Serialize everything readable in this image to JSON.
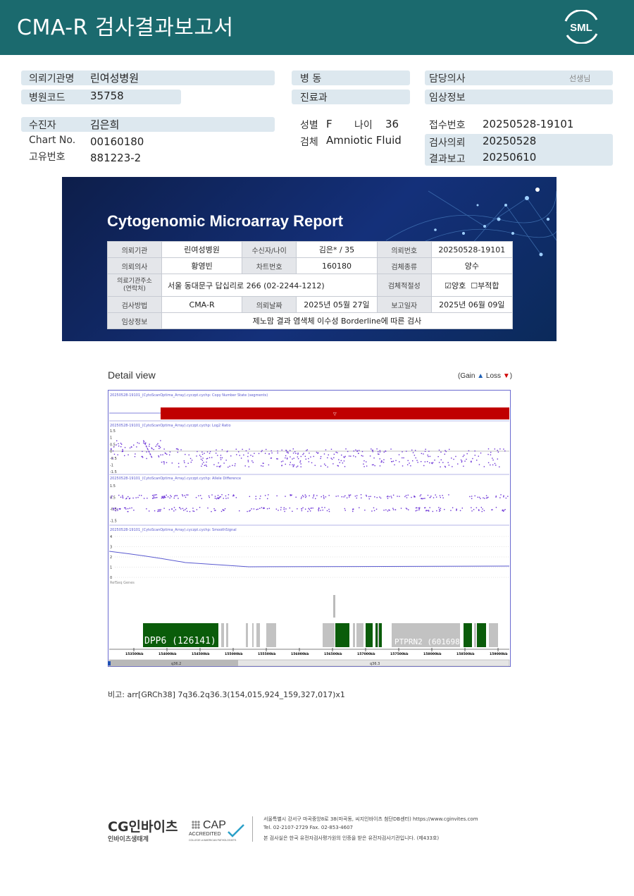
{
  "header": {
    "title": "CMA-R 검사결과보고서",
    "logo_text": "SML"
  },
  "info": {
    "institution_label": "의뢰기관명",
    "institution_value": "린여성병원",
    "hospital_code_label": "병원코드",
    "hospital_code_value": "35758",
    "ward_label": "병  동",
    "department_label": "진료과",
    "doctor_label": "담당의사",
    "doctor_suffix": "선생님",
    "clinical_info_label": "임상정보",
    "patient_label": "수진자",
    "patient_value": "김은희",
    "chart_label": "Chart No.",
    "chart_value": "00160180",
    "unique_label": "고유번호",
    "unique_value": "881223-2",
    "sex_label": "성별",
    "sex_value": "F",
    "age_label": "나이",
    "age_value": "36",
    "specimen_label": "검체",
    "specimen_value": "Amniotic Fluid",
    "receipt_label": "접수번호",
    "receipt_value": "20250528-19101",
    "request_label": "검사의뢰",
    "request_value": "20250528",
    "result_label": "결과보고",
    "result_value": "20250610"
  },
  "report": {
    "title": "Cytogenomic Microarray Report",
    "r1": [
      "의뢰기관",
      "린여성병원",
      "수신자/나이",
      "김은* / 35",
      "의뢰번호",
      "20250528-19101"
    ],
    "r2": [
      "의뢰의사",
      "황영빈",
      "차트번호",
      "160180",
      "검체종류",
      "양수"
    ],
    "r3": [
      "의료기관주소\n(연락처)",
      "서울 동대문구 답십리로 266 (02-2244-1212)",
      "검체적절성",
      "양호",
      "부적합"
    ],
    "r4": [
      "검사방법",
      "CMA-R",
      "의뢰날짜",
      "2025년 05월 27일",
      "보고일자",
      "2025년 06월 09일"
    ],
    "r5": [
      "임상정보",
      "제노맘 결과 염색체 이수성 Borderline에 따른 검사"
    ]
  },
  "detail": {
    "title": "Detail view",
    "legend_prefix": "(Gain",
    "legend_loss": "Loss",
    "legend_suffix": ")",
    "track1_label": "20250528-19101_(CytoScanOptima_Array).cyczpt.cychp: Copy Number State (segments)",
    "track2_label": "20250528-19101_(CytoScanOptima_Array).cyczpt.cychp: Log2 Ratio",
    "track3_label": "20250528-19101_(CytoScanOptima_Array).cyczpt.cychp: Allele Difference",
    "track4_label": "20250528-19101_(CytoScanOptima_Array).cyczpt.cychp: SmoothSignal",
    "log2_ticks": [
      "1.5",
      "1",
      "0.5",
      "0",
      "-0.5",
      "-1",
      "-1.5"
    ],
    "allele_ticks": [
      "1.5",
      "0.5",
      "-0.5",
      "-1.5"
    ],
    "smooth_ticks": [
      "4",
      "3",
      "2",
      "1",
      "0"
    ],
    "genes_label": "RefSeq Genes",
    "gene1": "DPP6 (126141)",
    "gene2": "PTPRN2 (601698)",
    "kb_ticks": [
      "153500kb",
      "154000kb",
      "154500kb",
      "155000kb",
      "155500kb",
      "156000kb",
      "156500kb",
      "157000kb",
      "157500kb",
      "158000kb",
      "158500kb",
      "159000kb"
    ],
    "band1": "q36.2",
    "band2": "q36.3"
  },
  "remark": {
    "label": "비고:",
    "text": "arr[GRCh38] 7q36.2q36.3(154,015,924_159,327,017)x1"
  },
  "footer": {
    "company": "CG인바이츠",
    "company_sub": "인바이츠생태계",
    "cap_title": "CAP",
    "cap_sub": "ACCREDITED",
    "cap_small": "COLLEGE of AMERICAN PATHOLOGISTS",
    "line1": "서울특별시 강서구 마곡중앙8로 38(마곡동, 씨지인바이츠 첨단DB센터)  https://www.cginvites.com",
    "line2": "Tel. 02-2107-2729   Fax. 02-853-4607",
    "line3": "본 검사실은 한국 유전자검사평가원의 인증을 받은 유전자검사기관입니다. (제433호)"
  },
  "colors": {
    "header": "#1b6a6e",
    "pill": "#dde8ef",
    "cnv": "#c00000",
    "gene": "#0a5c0a",
    "gene_gray": "#c2c2c2",
    "point": "#6b33d6"
  }
}
